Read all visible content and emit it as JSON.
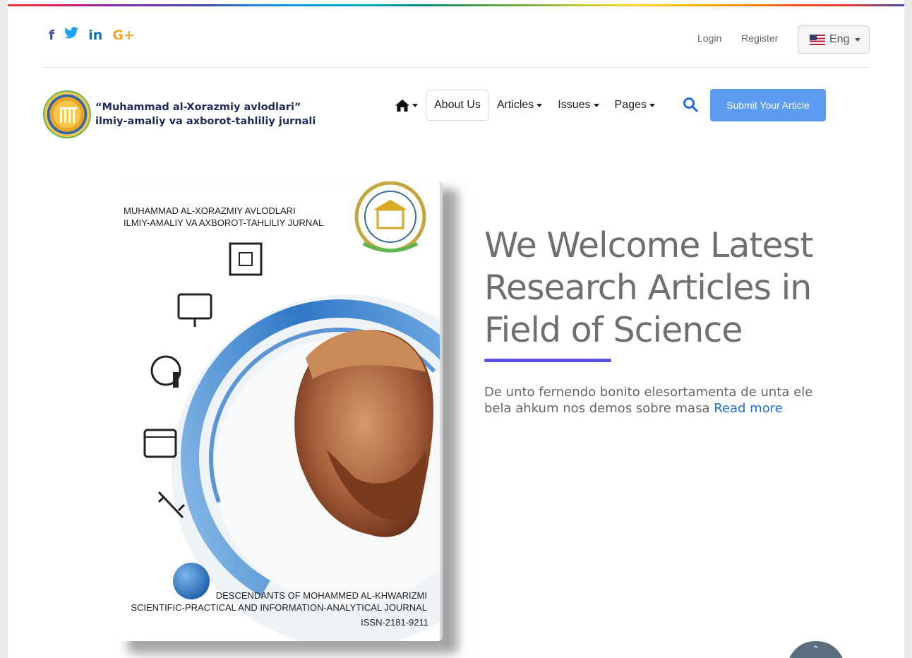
{
  "social": {
    "facebook_icon": "f",
    "twitter_icon": "t",
    "linkedin_icon": "in",
    "googleplus_icon": "G+"
  },
  "top_links": {
    "login": "Login",
    "register": "Register"
  },
  "language": {
    "selected": "Eng"
  },
  "logo": {
    "line1": "“Muhammad al-Xorazmiy avlodlari”",
    "line2": "ilmiy-amaliy va axborot-tahliliy jurnali"
  },
  "nav": {
    "items": [
      {
        "label": "About Us"
      },
      {
        "label": "Articles"
      },
      {
        "label": "Issues"
      },
      {
        "label": "Pages"
      }
    ],
    "submit_label": "Submit Your Article"
  },
  "cover": {
    "title_line1": "MUHAMMAD AL-XORAZMIY AVLODLARI",
    "title_line2": "ILMIY-AMALIY VA AXBOROT-TAHLILIY JURNAL",
    "bottom_line1": "DESCENDANTS OF MOHAMMED AL-KHWARIZMI",
    "bottom_line2": "SCIENTIFIC-PRACTICAL AND INFORMATION-ANALYTICAL JOURNAL",
    "issn": "ISSN-2181-9211"
  },
  "hero": {
    "title": "We Welcome Latest Research Articles in Field of Science",
    "description": "De unto fernendo bonito elesortamenta de unta ele bela ahkum nos demos sobre masa",
    "read_more": "Read more"
  },
  "colors": {
    "accent": "#5c9cf0",
    "underline": "#5a4fe6",
    "link": "#1e6fe0"
  }
}
